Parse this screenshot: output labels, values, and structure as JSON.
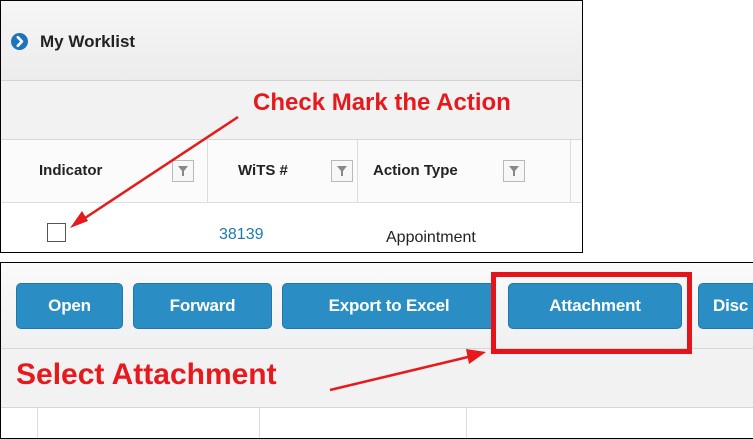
{
  "worklist": {
    "title": "My Worklist",
    "icon": "chevron-right-circle-icon",
    "columns": [
      {
        "label": "Indicator",
        "filter_icon": "filter-icon"
      },
      {
        "label": "WiTS #",
        "filter_icon": "filter-icon"
      },
      {
        "label": "Action Type",
        "filter_icon": "filter-icon"
      }
    ],
    "row": {
      "indicator_checked": false,
      "wits_number": "38139",
      "action_type": "Appointment"
    }
  },
  "toolbar": {
    "buttons": [
      "Open",
      "Forward",
      "Export to Excel",
      "Attachment",
      "Disc"
    ]
  },
  "annotations": {
    "check_mark": "Check Mark the Action",
    "select_attachment": "Select Attachment",
    "color": "#e8191c"
  },
  "colors": {
    "button_bg": "#2a8ec4",
    "link": "#1a7bb0",
    "header_icon": "#1f74b9"
  }
}
